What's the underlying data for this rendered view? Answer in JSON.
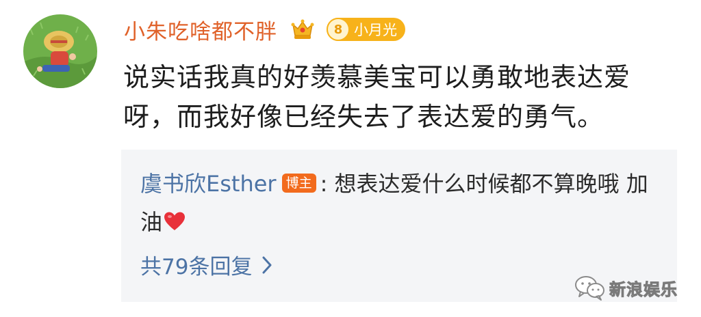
{
  "comment": {
    "username": "小朱吃啥都不胖",
    "level": "8",
    "level_label": "小月光",
    "text_line1": "说实话我真的好羡慕美宝可以勇敢地表达爱",
    "text_line2": "呀，而我好像已经失去了表达爱的勇气。"
  },
  "reply": {
    "author": "虞书欣Esther",
    "author_badge": "博主",
    "separator": ":",
    "text": " 想表达爱什么时候都不算晚哦 加油",
    "replies_link": "共79条回复"
  },
  "watermark": {
    "text": "新浪娱乐"
  },
  "icons": {
    "vip": "crown-badge-icon",
    "heart": "red-heart-icon",
    "chevron": "chevron-right-icon",
    "wechat": "wechat-logo-icon"
  },
  "colors": {
    "username": "#e0622a",
    "link_blue": "#4c73a5",
    "badge_orange": "#f26b1d",
    "level_gold": "#f7b21a",
    "reply_bg": "#f4f5f7"
  }
}
